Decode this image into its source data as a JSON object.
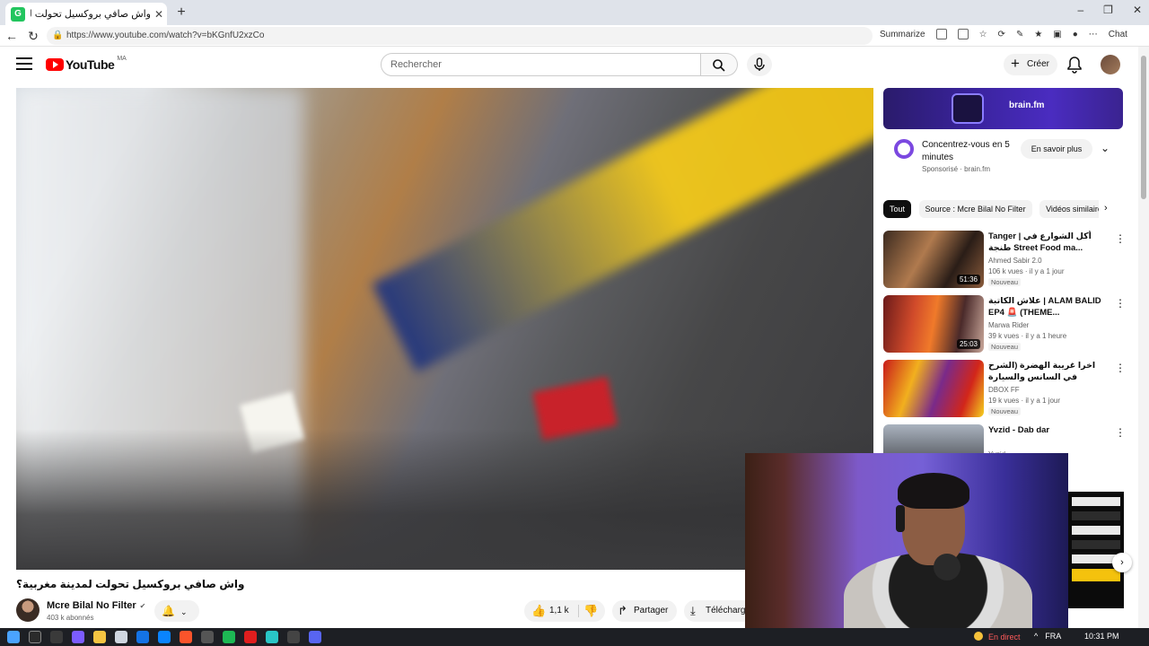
{
  "browser": {
    "tab_title": "واش صافي بروكسيل تحولت لمد",
    "tab_favicon": "G",
    "new_tab": "+",
    "url": "https://www.youtube.com/watch?v=bKGnfU2xzCo",
    "toolbar_summarize": "Summarize",
    "toolbar_chat": "Chat",
    "window_minimize": "–",
    "window_restore": "❐",
    "window_close": "✕"
  },
  "youtube": {
    "logo_text": "YouTube",
    "logo_country": "MA",
    "search_placeholder": "Rechercher",
    "create_label": "Créer"
  },
  "video": {
    "title": "واش صافي بروكسيل تحولت لمدينة مغربية؟",
    "channel_name": "Mcre Bilal No Filter",
    "subscribers": "403 k abonnés",
    "likes": "1,1 k",
    "share_label": "Partager",
    "download_label": "Télécharger"
  },
  "ad": {
    "brand": "brain.fm",
    "headline": "Concentrez-vous en 5 minutes",
    "sponsor": "Sponsorisé · brain.fm",
    "cta": "En savoir plus"
  },
  "chips": [
    "Tout",
    "Source : Mcre Bilal No Filter",
    "Vidéos similaires"
  ],
  "recommendations": [
    {
      "title": "Tanger | أكل الشوارع في طنجة Street Food ma...",
      "channel": "Ahmed Sabir 2.0",
      "meta": "106 k vues · il y a 1 jour",
      "badge": "Nouveau",
      "duration": "51:36"
    },
    {
      "title": "علاش الكاتبة | ALAM BALID EP4 🚨 (THEME...",
      "channel": "Marwa Rider",
      "meta": "39 k vues · il y a 1 heure",
      "badge": "Nouveau",
      "duration": "25:03"
    },
    {
      "title": "اخرا غريبة الهضرة (الشرح في السانس والسيارة",
      "channel": "DBOX FF",
      "meta": "19 k vues · il y a 1 jour",
      "badge": "Nouveau",
      "duration": ""
    },
    {
      "title": "Yvzid - Dab dar",
      "channel": "Yvzid",
      "meta": "",
      "badge": "",
      "duration": ""
    }
  ],
  "taskbar": {
    "live_label": "En direct",
    "lang": "FRA",
    "clock": "10:31 PM"
  }
}
